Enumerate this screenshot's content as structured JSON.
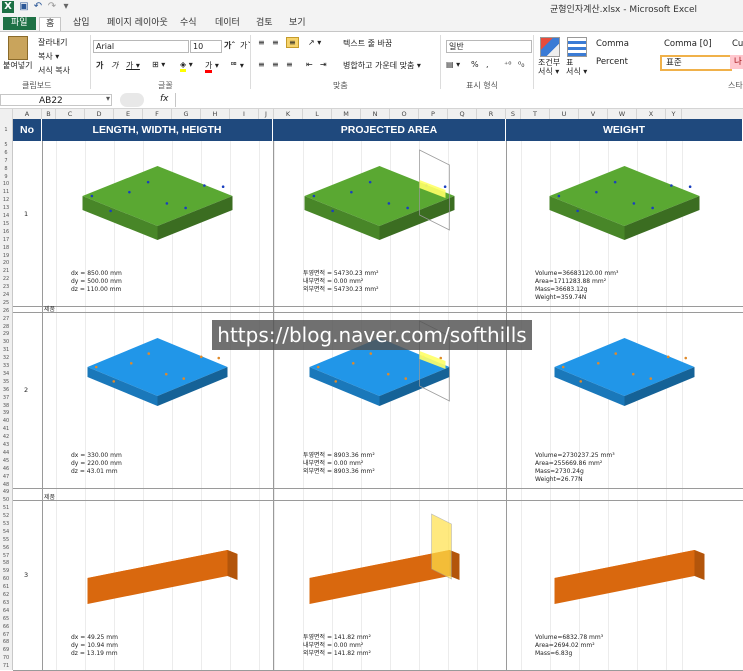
{
  "window": {
    "title": "균형인자계산.xlsx  -  Microsoft Excel"
  },
  "tabs": [
    {
      "label": "파일"
    },
    {
      "label": "홈"
    },
    {
      "label": "삽입"
    },
    {
      "label": "페이지 레이아웃"
    },
    {
      "label": "수식"
    },
    {
      "label": "데이터"
    },
    {
      "label": "검토"
    },
    {
      "label": "보기"
    }
  ],
  "ribbon": {
    "paste": "붙여넣기",
    "cut": "잘라내기",
    "copy": "복사 ▾",
    "format_painter": "서식 복사",
    "clipboard_label": "클립보드",
    "font_name": "Arial",
    "font_size": "10",
    "font_label": "글꼴",
    "wrap_text": "텍스트 줄 바꿈",
    "merge_center": "병합하고 가운데 맞춤 ▾",
    "align_label": "맞춤",
    "number_format": "일반",
    "number_label": "표시 형식",
    "percent": "%",
    "comma_btn": ",",
    "cond_format": "조건부\n서식 ▾",
    "table_format": "표\n서식 ▾",
    "styles": {
      "comma": "Comma",
      "comma0": "Comma [0]",
      "cu": "Cu",
      "percent": "Percent",
      "normal": "표준",
      "bad": "나",
      "style_label": "스타"
    }
  },
  "formula_bar": {
    "name_box": "AB22",
    "fx": "fx",
    "value": ""
  },
  "columns": [
    "A",
    "B",
    "C",
    "D",
    "E",
    "F",
    "G",
    "H",
    "I",
    "J",
    "K",
    "L",
    "M",
    "N",
    "O",
    "P",
    "Q",
    "R",
    "S",
    "T",
    "U",
    "V",
    "W",
    "X",
    "Y"
  ],
  "rows": [
    "1",
    "5",
    "6",
    "7",
    "8",
    "9",
    "10",
    "11",
    "12",
    "13",
    "14",
    "15",
    "16",
    "17",
    "18",
    "19",
    "20",
    "21",
    "22",
    "23",
    "24",
    "25",
    "26",
    "27",
    "28",
    "29",
    "30",
    "31",
    "32",
    "33",
    "34",
    "35",
    "36",
    "37",
    "38",
    "39",
    "40",
    "41",
    "42",
    "43",
    "44",
    "45",
    "46",
    "47",
    "48",
    "49",
    "50",
    "51",
    "52",
    "53",
    "54",
    "55",
    "56",
    "57",
    "58",
    "59",
    "60",
    "61",
    "62",
    "63",
    "64",
    "65",
    "66",
    "67",
    "68",
    "69",
    "70",
    "71"
  ],
  "table": {
    "headers": [
      "No",
      "LENGTH, WIDTH, HEIGTH",
      "PROJECTED AREA",
      "WEIGHT"
    ],
    "items": [
      {
        "no": "1",
        "dims": [
          "dx = 850.00 mm",
          "dy = 500.00 mm",
          "dz = 110.00 mm"
        ],
        "area": [
          "투영면적 = 54730.23 mm²",
          "내부면적 = 0.00 mm²",
          "외부면적 = 54730.23 mm²"
        ],
        "weight": [
          "Volume=36683120.00 mm³",
          "Area=1711283.88 mm²",
          "Mass=36683.12g",
          "Weight=359.74N"
        ],
        "color": "#5aa832",
        "tag": ""
      },
      {
        "no": "2",
        "dims": [
          "dx = 330.00 mm",
          "dy = 220.00 mm",
          "dz = 43.01 mm"
        ],
        "area": [
          "투영면적 = 8903.36 mm²",
          "내부면적 = 0.00 mm²",
          "외부면적 = 8903.36 mm²"
        ],
        "weight": [
          "Volume=2730237.25 mm³",
          "Area=255669.86 mm²",
          "Mass=2730.24g",
          "Weight=26.77N"
        ],
        "color": "#2196e8",
        "tag": "제품"
      },
      {
        "no": "3",
        "dims": [
          "dx = 49.25 mm",
          "dy = 10.94 mm",
          "dz = 13.19 mm"
        ],
        "area": [
          "투영면적 = 141.82 mm²",
          "내부면적 = 0.00 mm²",
          "외부면적 = 141.82 mm²"
        ],
        "weight": [
          "Volume=6832.78 mm³",
          "Area=2694.02 mm²",
          "Mass=6.83g"
        ],
        "color": "#ff7a10",
        "tag": "제품"
      }
    ]
  },
  "watermark": "https://blog.naver.com/softhills"
}
